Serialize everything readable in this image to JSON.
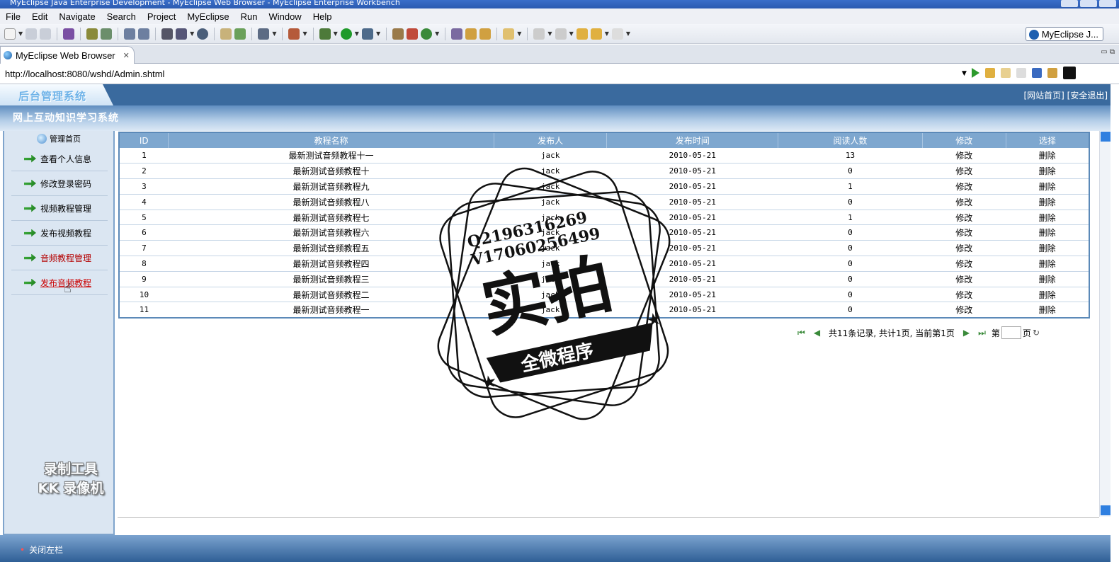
{
  "window": {
    "title": "MyEclipse Java Enterprise Development - MyEclipse Web Browser - MyEclipse Enterprise Workbench"
  },
  "menu": [
    "File",
    "Edit",
    "Navigate",
    "Search",
    "Project",
    "MyEclipse",
    "Run",
    "Window",
    "Help"
  ],
  "perspective": {
    "label": "MyEclipse J..."
  },
  "editor_tab": {
    "label": "MyEclipse Web Browser"
  },
  "address": {
    "url": "http://localhost:8080/wshd/Admin.shtml"
  },
  "header": {
    "logo": "后台管理系统",
    "links": "[网站首页] [安全退出]",
    "site_name": "网上互动知识学习系统"
  },
  "sidebar": {
    "home": "管理首页",
    "items": [
      {
        "label": "查看个人信息"
      },
      {
        "label": "修改登录密码"
      },
      {
        "label": "视频教程管理"
      },
      {
        "label": "发布视频教程"
      },
      {
        "label": "音频教程管理"
      },
      {
        "label": "发布音频教程"
      }
    ]
  },
  "table": {
    "headers": [
      "ID",
      "教程名称",
      "发布人",
      "发布时间",
      "阅读人数",
      "修改",
      "选择"
    ],
    "rows": [
      [
        "1",
        "最新测试音频教程十一",
        "jack",
        "2010-05-21",
        "13",
        "修改",
        "删除"
      ],
      [
        "2",
        "最新测试音频教程十",
        "jack",
        "2010-05-21",
        "0",
        "修改",
        "删除"
      ],
      [
        "3",
        "最新测试音频教程九",
        "jack",
        "2010-05-21",
        "1",
        "修改",
        "删除"
      ],
      [
        "4",
        "最新测试音频教程八",
        "jack",
        "2010-05-21",
        "0",
        "修改",
        "删除"
      ],
      [
        "5",
        "最新测试音频教程七",
        "jack",
        "2010-05-21",
        "1",
        "修改",
        "删除"
      ],
      [
        "6",
        "最新测试音频教程六",
        "jack",
        "2010-05-21",
        "0",
        "修改",
        "删除"
      ],
      [
        "7",
        "最新测试音频教程五",
        "jack",
        "2010-05-21",
        "0",
        "修改",
        "删除"
      ],
      [
        "8",
        "最新测试音频教程四",
        "jack",
        "2010-05-21",
        "0",
        "修改",
        "删除"
      ],
      [
        "9",
        "最新测试音频教程三",
        "jack",
        "2010-05-21",
        "0",
        "修改",
        "删除"
      ],
      [
        "10",
        "最新测试音频教程二",
        "jack",
        "2010-05-21",
        "0",
        "修改",
        "删除"
      ],
      [
        "11",
        "最新测试音频教程一",
        "jack",
        "2010-05-21",
        "0",
        "修改",
        "删除"
      ]
    ]
  },
  "pager": {
    "summary": "共11条记录, 共计1页, 当前第1页",
    "page_prefix": "第",
    "page_suffix": "页"
  },
  "footer": {
    "close_left": "关闭左栏"
  },
  "watermark": {
    "recorder_line1": "录制工具",
    "recorder_line2": "KK 录像机",
    "stamp_line1": "Q2196316269",
    "stamp_line2": "V17060256499",
    "stamp_big": "实拍",
    "stamp_banner": "全微程序"
  },
  "colors": {
    "header_blue": "#3a6a9e",
    "table_header": "#7ea7cf",
    "sidebar_bg": "#dbe6f2"
  }
}
